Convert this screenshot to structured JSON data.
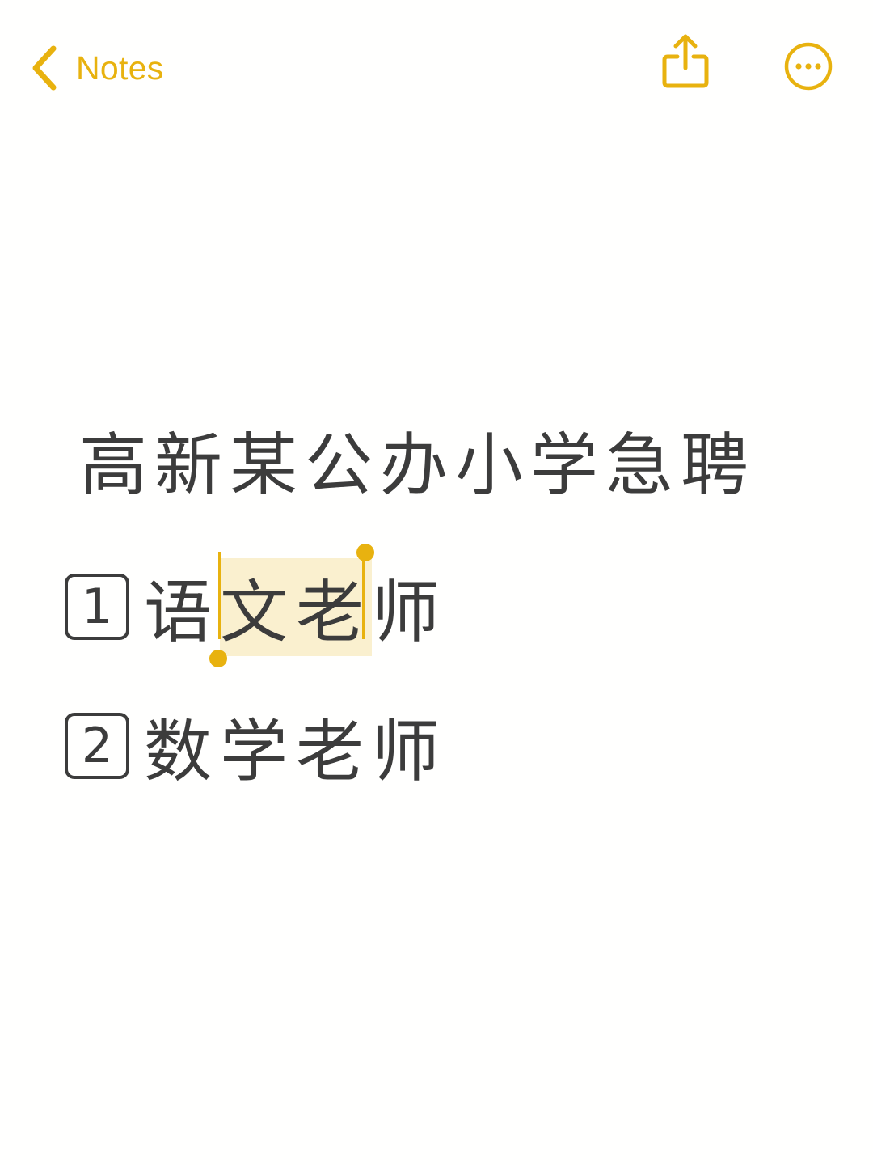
{
  "nav": {
    "back_label": "Notes",
    "accent_color": "#e8b20f",
    "icons": [
      "chevron-left-icon",
      "share-icon",
      "more-icon"
    ]
  },
  "note": {
    "title": "高新某公办小学急聘",
    "items": [
      {
        "number": "1",
        "before": "语",
        "selected": "文老",
        "after": "师"
      },
      {
        "number": "2",
        "before": "数学老师",
        "selected": "",
        "after": ""
      }
    ]
  }
}
